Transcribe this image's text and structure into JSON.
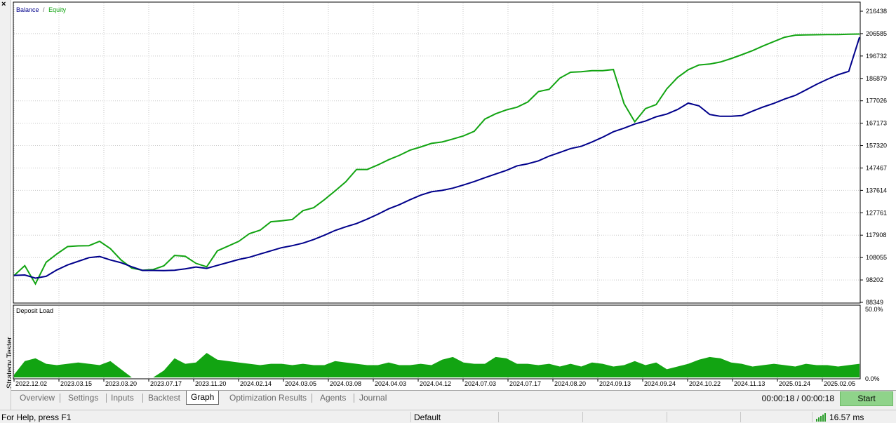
{
  "side_panel": {
    "title": "Strategy Tester",
    "close_glyph": "×"
  },
  "legend": {
    "balance": "Balance",
    "separator": "/",
    "equity": "Equity"
  },
  "colors": {
    "balance": "#00008b",
    "equity": "#12a412",
    "deposit_load": "#12a412",
    "grid": "#c8c8c8"
  },
  "subchart": {
    "title": "Deposit Load",
    "ylabels": [
      "50.0%",
      "0.0%"
    ]
  },
  "chart_data": {
    "type": "line",
    "ylabels": [
      "216438",
      "206585",
      "196732",
      "186879",
      "177026",
      "167173",
      "157320",
      "147467",
      "137614",
      "127761",
      "117908",
      "108055",
      "98202",
      "88349"
    ],
    "xlabels": [
      "2022.12.02",
      "2023.03.15",
      "2023.03.20",
      "2023.07.17",
      "2023.11.20",
      "2024.02.14",
      "2024.03.05",
      "2024.03.08",
      "2024.04.03",
      "2024.04.12",
      "2024.07.03",
      "2024.07.17",
      "2024.08.20",
      "2024.09.13",
      "2024.09.24",
      "2024.10.22",
      "2024.11.13",
      "2025.01.24",
      "2025.02.05"
    ],
    "ylim": [
      88349,
      216438
    ],
    "series": [
      {
        "name": "Balance",
        "values": [
          100200,
          100400,
          99000,
          99800,
          102600,
          104800,
          106400,
          108000,
          108500,
          107000,
          105800,
          104000,
          102400,
          102400,
          102300,
          102500,
          103100,
          103900,
          103300,
          104600,
          105900,
          107200,
          108200,
          109600,
          111000,
          112400,
          113300,
          114400,
          116000,
          117900,
          120000,
          121600,
          123000,
          125000,
          127100,
          129500,
          131300,
          133500,
          135500,
          137000,
          137600,
          138600,
          140000,
          141500,
          143200,
          144800,
          146400,
          148400,
          149300,
          150600,
          152700,
          154300,
          156000,
          157000,
          158900,
          161000,
          163400,
          165000,
          166800,
          168100,
          170000,
          171200,
          173200,
          176000,
          174800,
          171000,
          170200,
          170200,
          170500,
          172500,
          174300,
          175900,
          177800,
          179400,
          181800,
          184300,
          186500,
          188500,
          190000,
          205000
        ]
      },
      {
        "name": "Equity",
        "values": [
          100100,
          104500,
          96500,
          106000,
          109600,
          112900,
          113200,
          113300,
          115200,
          112000,
          107000,
          103400,
          102500,
          102800,
          104400,
          109000,
          108600,
          105500,
          104000,
          111000,
          113100,
          115200,
          118600,
          120100,
          123800,
          124200,
          124800,
          128700,
          130000,
          133500,
          137400,
          141400,
          146800,
          146800,
          148800,
          151100,
          153000,
          155300,
          156700,
          158300,
          158900,
          160200,
          161600,
          163600,
          169000,
          171300,
          173000,
          174200,
          176500,
          181100,
          182100,
          187000,
          189600,
          189800,
          190300,
          190300,
          190800,
          175800,
          167800,
          173600,
          175400,
          182300,
          187300,
          190700,
          192800,
          193200,
          194100,
          195600,
          197300,
          199100,
          201200,
          203100,
          205000,
          205900,
          206000,
          206100,
          206200,
          206200,
          206300,
          206400
        ]
      },
      {
        "name": "Deposit Load",
        "values": [
          2,
          12,
          14,
          10,
          9,
          10,
          11,
          10,
          9,
          12,
          6,
          0,
          0,
          0,
          5,
          14,
          10,
          11,
          18,
          13,
          12,
          11,
          10,
          9,
          10,
          10,
          9,
          10,
          9,
          9,
          12,
          11,
          10,
          9,
          9,
          11,
          9,
          9,
          10,
          9,
          13,
          15,
          11,
          10,
          10,
          15,
          14,
          10,
          10,
          9,
          10,
          8,
          10,
          8,
          11,
          10,
          8,
          9,
          12,
          9,
          11,
          6,
          8,
          10,
          13,
          15,
          14,
          11,
          10,
          8,
          9,
          10,
          9,
          8,
          10,
          9,
          9,
          8,
          9,
          10
        ]
      }
    ]
  },
  "tabs": [
    "Overview",
    "Settings",
    "Inputs",
    "Backtest",
    "Graph",
    "Optimization Results",
    "Agents",
    "Journal"
  ],
  "active_tab": "Graph",
  "timer": "00:00:18 / 00:00:18",
  "start_button": "Start",
  "status": {
    "help": "For Help, press F1",
    "profile": "Default",
    "latency": "16.57 ms"
  }
}
